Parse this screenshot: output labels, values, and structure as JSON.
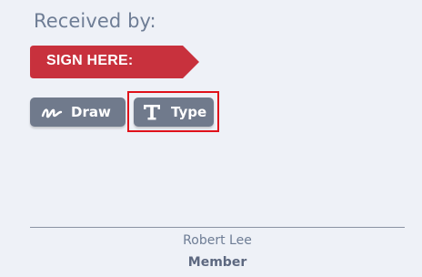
{
  "section": {
    "title": "Received by:"
  },
  "sign_tab": {
    "label": "SIGN HERE:",
    "color": "#c8313d"
  },
  "signature_modes": {
    "draw": {
      "label": "Draw",
      "icon": "signature-scribble-icon"
    },
    "type": {
      "label": "Type",
      "icon": "text-type-icon"
    },
    "selected": "Type"
  },
  "signer": {
    "name": "Robert Lee",
    "role": "Member"
  },
  "colors": {
    "background": "#eef1f7",
    "button": "#707a8c",
    "highlight": "#e0121b",
    "label_text": "#6e7d95"
  }
}
